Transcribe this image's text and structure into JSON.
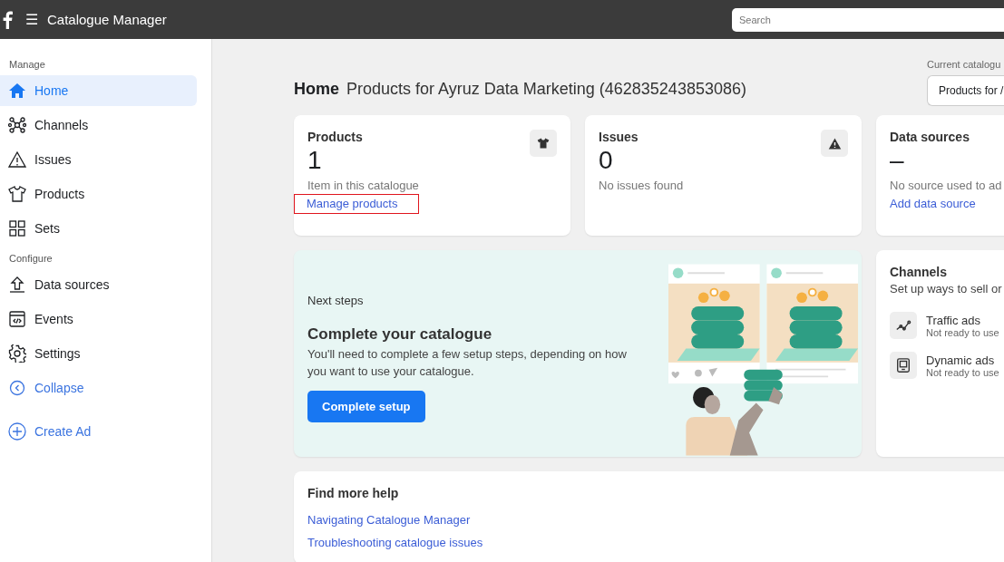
{
  "topbar": {
    "menu_glyph": "☰",
    "title": "Catalogue Manager",
    "search": {
      "placeholder": "Search"
    }
  },
  "sidebar": {
    "sections": [
      {
        "heading": "Manage",
        "items": [
          {
            "label": "Home",
            "kind": "home",
            "selected": true
          },
          {
            "label": "Channels",
            "kind": "channels",
            "selected": false
          },
          {
            "label": "Issues",
            "kind": "issues",
            "selected": false
          },
          {
            "label": "Products",
            "kind": "products",
            "selected": false
          },
          {
            "label": "Sets",
            "kind": "sets",
            "selected": false
          }
        ]
      },
      {
        "heading": "Configure",
        "items": [
          {
            "label": "Data sources",
            "kind": "datasources",
            "selected": false
          },
          {
            "label": "Events",
            "kind": "events",
            "selected": false
          },
          {
            "label": "Settings",
            "kind": "settings",
            "selected": false
          }
        ]
      }
    ],
    "collapse": "Collapse",
    "create_ad": "Create Ad"
  },
  "header": {
    "page": "Home",
    "catalogue": "Products for Ayruz Data Marketing (462835243853086)",
    "current_label": "Current catalogu",
    "current_value": "Products for /"
  },
  "stats": [
    {
      "title": "Products",
      "value": "1",
      "caption": "Item in this catalogue",
      "link": "Manage products",
      "highlighted": true,
      "kind": "products"
    },
    {
      "title": "Issues",
      "value": "0",
      "caption": "No issues found",
      "kind": "issues"
    },
    {
      "title": "Data sources",
      "kind": "sources",
      "value": "–",
      "caption": "No source used to ad",
      "link": "Add data source",
      "highlighted": false
    }
  ],
  "next_steps": {
    "eyebrow": "Next steps",
    "title": "Complete your catalogue",
    "text": "You'll need to complete a few setup steps, depending on how you want to use your catalogue.",
    "button": "Complete setup"
  },
  "channels": {
    "title": "Channels",
    "subtitle": "Set up ways to sell or",
    "items": [
      {
        "name": "Traffic ads",
        "status": "Not ready to use",
        "kind": "traffic"
      },
      {
        "name": "Dynamic ads",
        "status": "Not ready to use",
        "kind": "dynamic"
      }
    ]
  },
  "help": {
    "title": "Find more help",
    "links": [
      "Navigating Catalogue Manager",
      "Troubleshooting catalogue issues"
    ]
  }
}
